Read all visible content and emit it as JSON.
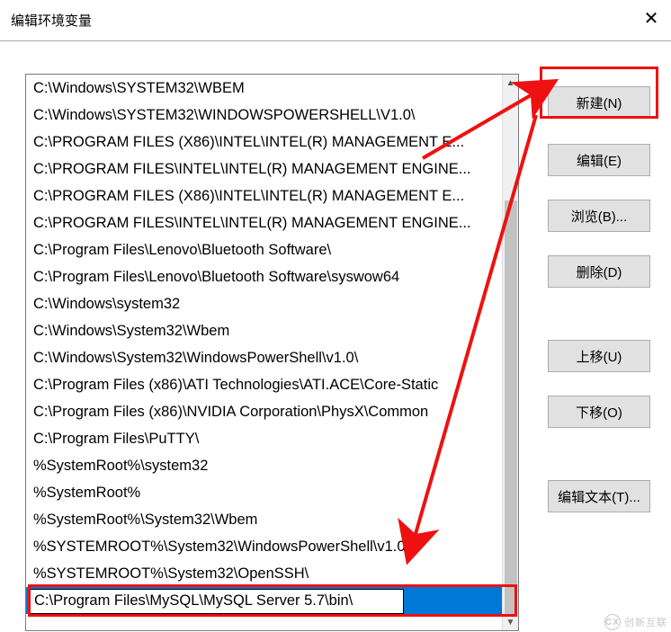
{
  "window": {
    "title": "编辑环境变量"
  },
  "list": {
    "items": [
      "C:\\Windows\\SYSTEM32\\WBEM",
      "C:\\Windows\\SYSTEM32\\WINDOWSPOWERSHELL\\V1.0\\",
      "C:\\PROGRAM FILES (X86)\\INTEL\\INTEL(R) MANAGEMENT E...",
      "C:\\PROGRAM FILES\\INTEL\\INTEL(R) MANAGEMENT ENGINE...",
      "C:\\PROGRAM FILES (X86)\\INTEL\\INTEL(R) MANAGEMENT E...",
      "C:\\PROGRAM FILES\\INTEL\\INTEL(R) MANAGEMENT ENGINE...",
      "C:\\Program Files\\Lenovo\\Bluetooth Software\\",
      "C:\\Program Files\\Lenovo\\Bluetooth Software\\syswow64",
      "C:\\Windows\\system32",
      "C:\\Windows\\System32\\Wbem",
      "C:\\Windows\\System32\\WindowsPowerShell\\v1.0\\",
      "C:\\Program Files (x86)\\ATI Technologies\\ATI.ACE\\Core-Static",
      "C:\\Program Files (x86)\\NVIDIA Corporation\\PhysX\\Common",
      "C:\\Program Files\\PuTTY\\",
      "%SystemRoot%\\system32",
      "%SystemRoot%",
      "%SystemRoot%\\System32\\Wbem",
      "%SYSTEMROOT%\\System32\\WindowsPowerShell\\v1.0\\",
      "%SYSTEMROOT%\\System32\\OpenSSH\\"
    ],
    "editing_value": "C:\\Program Files\\MySQL\\MySQL Server 5.7\\bin\\"
  },
  "buttons": {
    "new": "新建(N)",
    "edit": "编辑(E)",
    "browse": "浏览(B)...",
    "delete": "删除(D)",
    "up": "上移(U)",
    "down": "下移(O)",
    "edit_text": "编辑文本(T)..."
  },
  "watermark": {
    "brand_short": "CX",
    "brand": "创新互联"
  }
}
